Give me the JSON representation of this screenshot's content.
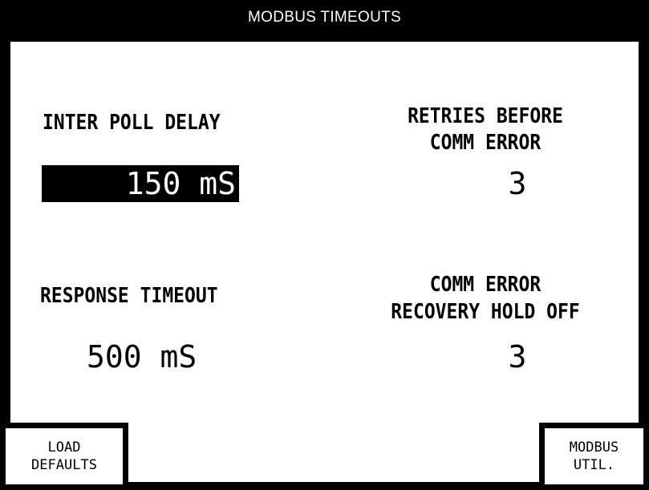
{
  "header": {
    "title": "MODBUS TIMEOUTS"
  },
  "inter_poll_delay": {
    "label": "INTER POLL DELAY",
    "value": "150 mS"
  },
  "retries_before_comm_error": {
    "label_line1": "RETRIES BEFORE",
    "label_line2": "COMM ERROR",
    "value": "3"
  },
  "response_timeout": {
    "label": "RESPONSE TIMEOUT",
    "value": "500 mS"
  },
  "comm_error_recovery_hold_off": {
    "label_line1": "COMM ERROR",
    "label_line2": "RECOVERY HOLD OFF",
    "value": "3"
  },
  "softkeys": {
    "load_defaults": {
      "line1": "LOAD",
      "line2": "DEFAULTS"
    },
    "modbus_util": {
      "line1": "MODBUS",
      "line2": "UTIL."
    }
  },
  "colors": {
    "background": "#ffffff",
    "foreground": "#000000",
    "highlight": "#000000"
  }
}
